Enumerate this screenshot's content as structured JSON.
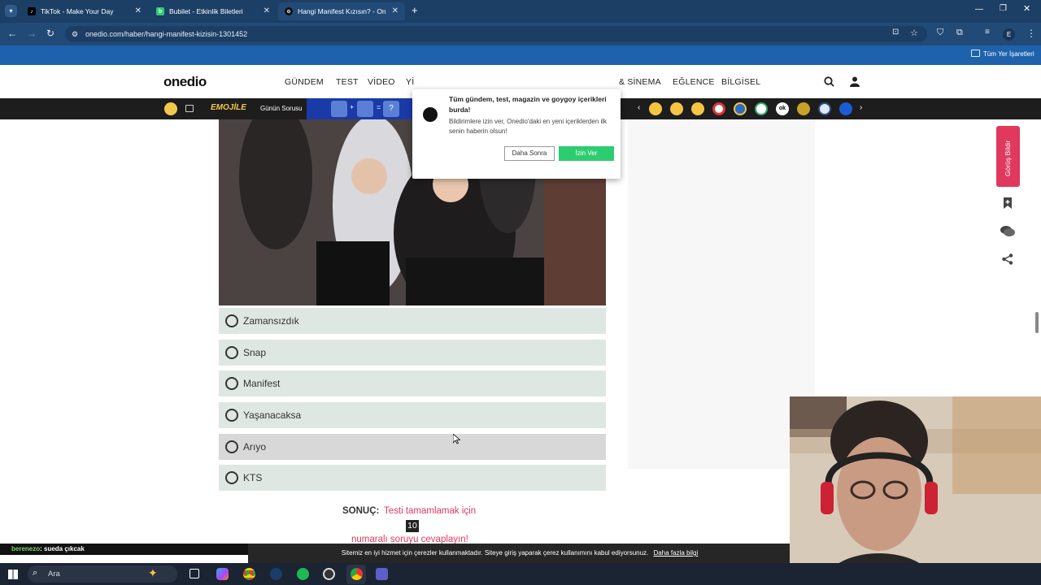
{
  "browser": {
    "tabs": [
      {
        "title": "TikTok - Make Your Day",
        "icon": "tiktok-icon",
        "color": "#000000"
      },
      {
        "title": "Bubilet - Etkinlik Biletleri",
        "icon": "bubilet-icon",
        "color": "#2ecc71"
      },
      {
        "title": "Hangi Manifest Kızısın? - Onedio",
        "icon": "onedio-icon",
        "color": "#111111"
      }
    ],
    "url": "onedio.com/haber/hangi-manifest-kizisin-1301452",
    "bookmarks_label": "Tüm Yer İşaretleri",
    "profile_initial": "E"
  },
  "site": {
    "logo": "onedio",
    "nav": [
      "GÜNDEM",
      "TEST",
      "VİDEO",
      "Yİ",
      "& SİNEMA",
      "EĞLENCE",
      "BİLGİSEL"
    ],
    "emoji_bar": {
      "emojile": "EMOJİLE",
      "gunun_sorusu": "Günün Sorusu",
      "question_mark": "?"
    }
  },
  "notification_popup": {
    "title": "Tüm gündem, test, magazin ve goygoy içerikleri burda!",
    "body": "Bildirimlere izin ver, Onedio'daki en yeni içeriklerden ilk senin haberin olsun!",
    "later_label": "Daha Sonra",
    "allow_label": "İzin Ver",
    "allow_color": "#2ecc71"
  },
  "quiz": {
    "options": [
      "Zamansızdık",
      "Snap",
      "Manifest",
      "Yaşanacaksa",
      "Arıyo",
      "KTS"
    ],
    "result_label": "SONUÇ:",
    "result_text_1": "Testi tamamlamak için",
    "result_number": "10",
    "result_text_2": "numaralı soruyu cevaplayın!",
    "accent_color": "#e0395d"
  },
  "side_actions": {
    "report_label": "Görüş Bildir",
    "report_color": "#e0395d"
  },
  "cookie": {
    "text": "Sitemiz en iyi hizmet için çerezler kullanmaktadır. Siteye giriş yaparak çerez kullanımını kabul ediyorsunuz.",
    "link": "Daha fazla bilgi"
  },
  "chat": {
    "user": "berenezo",
    "message": ": sueda çıkcak"
  },
  "taskbar": {
    "search_placeholder": "Ara"
  }
}
